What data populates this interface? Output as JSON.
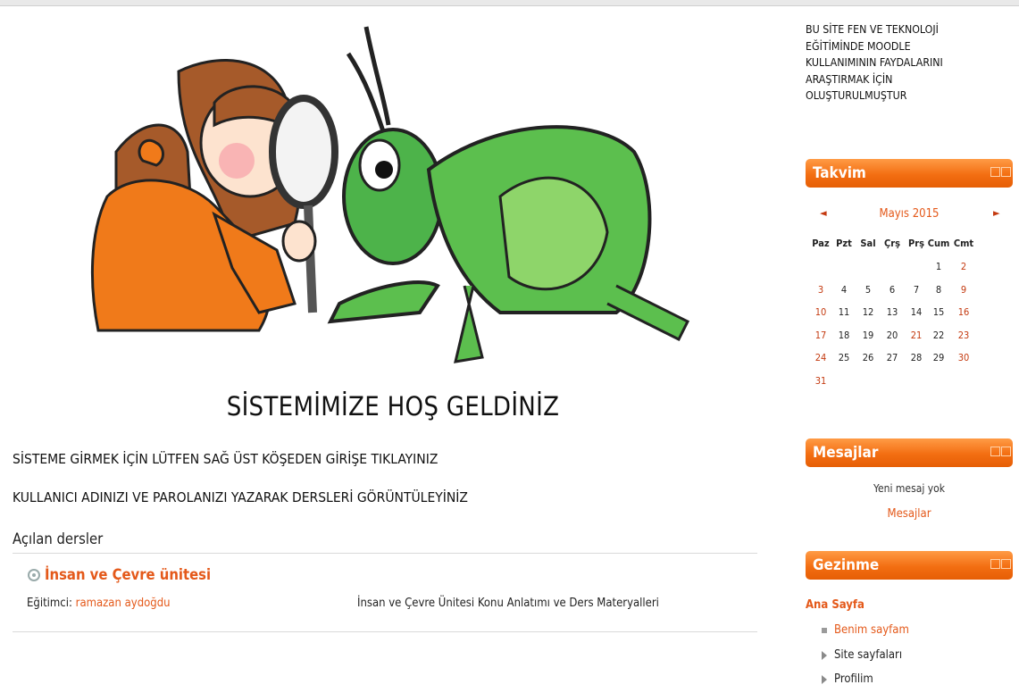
{
  "main": {
    "welcome": "SİSTEMİMİZE HOŞ GELDİNİZ",
    "line1": "SİSTEME GİRMEK İÇİN LÜTFEN SAĞ ÜST KÖŞEDEN GİRİŞE TIKLAYINIZ",
    "line2": "KULLANICI ADINIZI VE PAROLANIZI YAZARAK DERSLERİ GÖRÜNTÜLEYİNİZ",
    "courses_heading": "Açılan dersler",
    "course": {
      "title": "İnsan ve Çevre ünitesi",
      "teacher_label": "Eğitimci:",
      "teacher_name": "ramazan aydoğdu",
      "summary": "İnsan ve Çevre Ünitesi Konu Anlatımı ve Ders Materyalleri"
    }
  },
  "sidebar": {
    "site_description": "BU SİTE FEN VE TEKNOLOJİ\n EĞİTİMİNDE MOODLE\nKULLANIMININ FAYDALARINI\nARAŞTIRMAK İÇİN\nOLUŞTURULMUŞTUR",
    "calendar": {
      "title": "Takvim",
      "month": "Mayıs 2015",
      "prev": "◄",
      "next": "►",
      "weekdays": [
        "Paz",
        "Pzt",
        "Sal",
        "Çrş",
        "Prş",
        "Cum",
        "Cmt"
      ],
      "weeks": [
        [
          "",
          "",
          "",
          "",
          "",
          "1",
          "2"
        ],
        [
          "3",
          "4",
          "5",
          "6",
          "7",
          "8",
          "9"
        ],
        [
          "10",
          "11",
          "12",
          "13",
          "14",
          "15",
          "16"
        ],
        [
          "17",
          "18",
          "19",
          "20",
          "21",
          "22",
          "23"
        ],
        [
          "24",
          "25",
          "26",
          "27",
          "28",
          "29",
          "30"
        ],
        [
          "31",
          "",
          "",
          "",
          "",
          "",
          ""
        ]
      ]
    },
    "messages": {
      "title": "Mesajlar",
      "none": "Yeni mesaj yok",
      "link": "Mesajlar"
    },
    "navigation": {
      "title": "Gezinme",
      "home": "Ana Sayfa",
      "items": [
        "Benim sayfam",
        "Site sayfaları",
        "Profilim"
      ]
    }
  },
  "colors": {
    "accent": "#e4591a",
    "block_header": "#f36e12"
  }
}
